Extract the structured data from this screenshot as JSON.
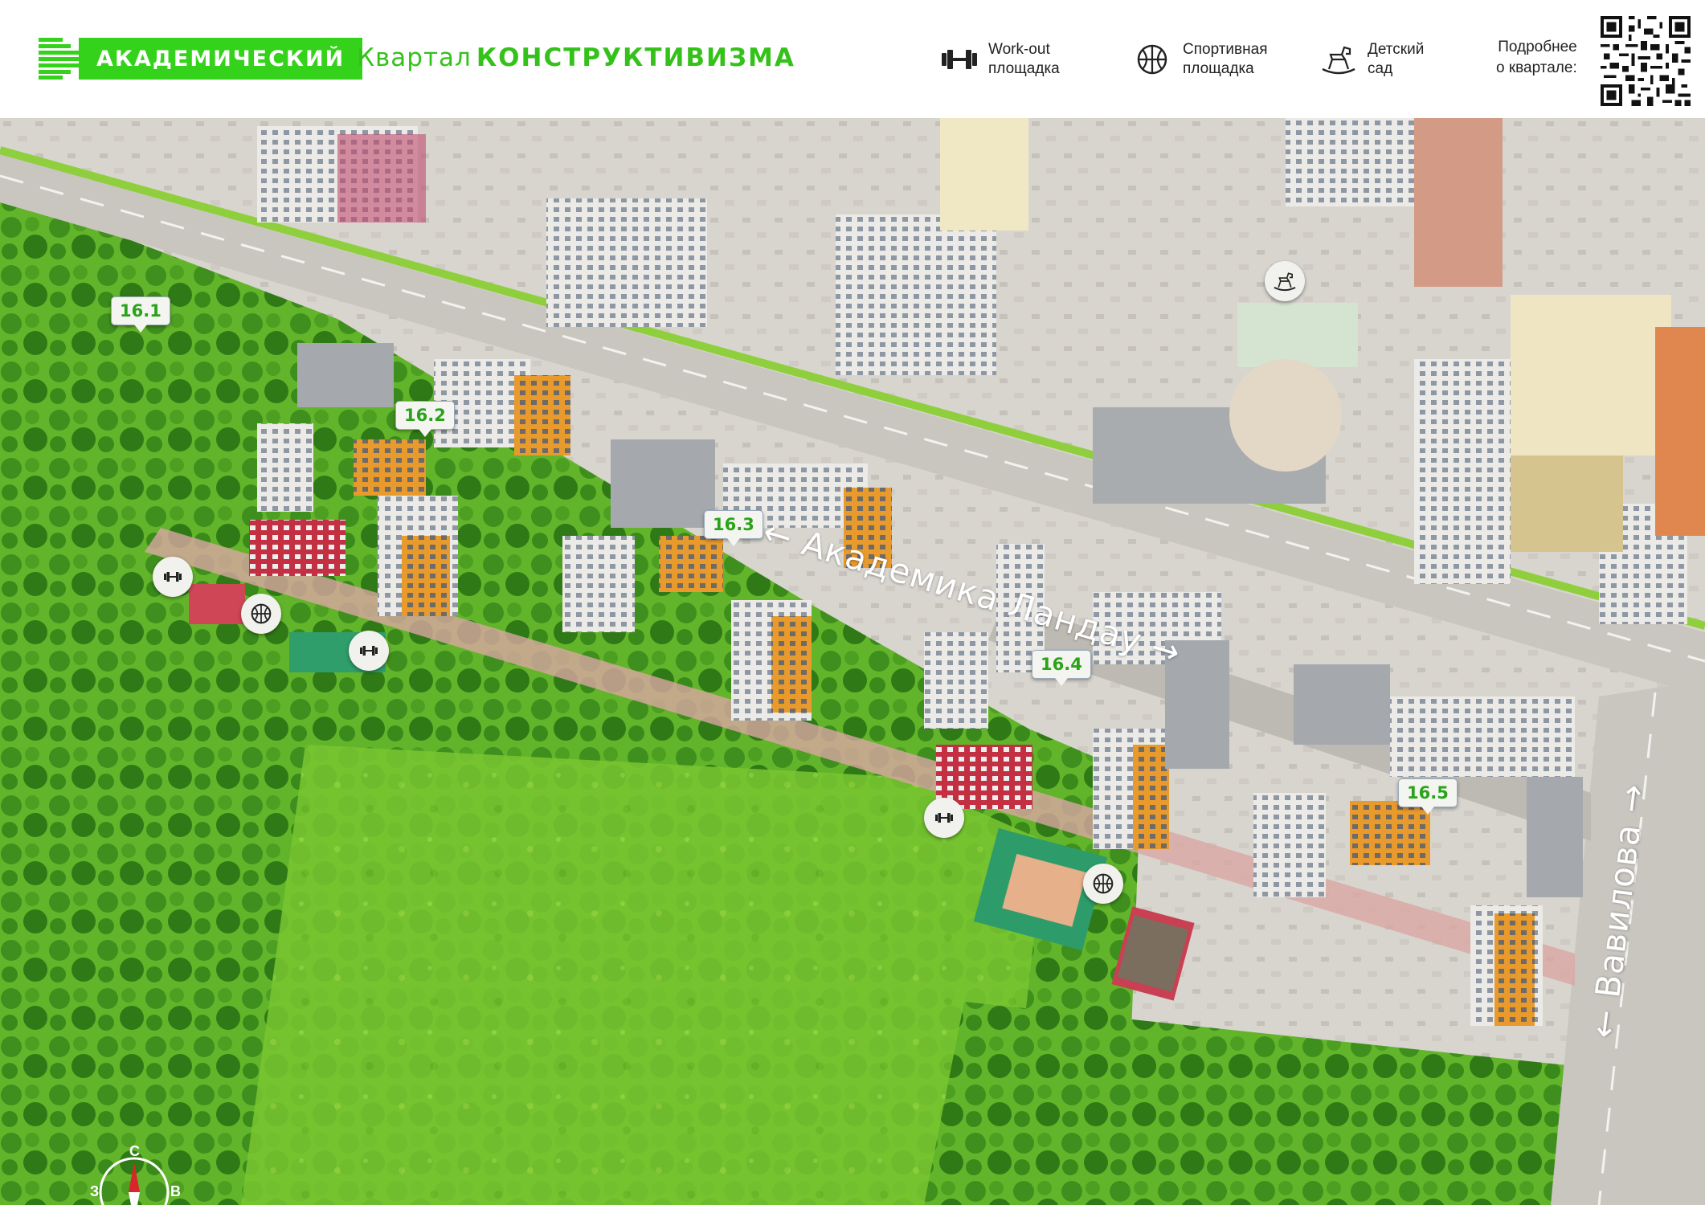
{
  "header": {
    "logo_text": "АКАДЕМИЧЕСКИЙ",
    "title_prefix": "Квартал",
    "title_emphasis": "КОНСТРУКТИВИЗМА",
    "legend": [
      {
        "icon": "dumbbell-icon",
        "line1": "Work-out",
        "line2": "площадка"
      },
      {
        "icon": "basketball-icon",
        "line1": "Спортивная",
        "line2": "площадка"
      },
      {
        "icon": "rocking-horse-icon",
        "line1": "Детский",
        "line2": "сад"
      }
    ],
    "more_line1": "Подробнее",
    "more_line2": "о квартале:",
    "qr_icon": "qr-code-icon"
  },
  "colors": {
    "brand_green": "#34d21a",
    "pin_text_green": "#2aa31a",
    "grass": "#6cc22a",
    "road": "#c9c6c0"
  },
  "map": {
    "plots": [
      {
        "id": "plot-16-1",
        "label": "16.1"
      },
      {
        "id": "plot-16-2",
        "label": "16.2"
      },
      {
        "id": "plot-16-3",
        "label": "16.3"
      },
      {
        "id": "plot-16-4",
        "label": "16.4"
      },
      {
        "id": "plot-16-5",
        "label": "16.5"
      }
    ],
    "streets": [
      {
        "id": "landau",
        "label": "← Академика Ландау →"
      },
      {
        "id": "vavilova",
        "label": "← Вавилова →"
      }
    ],
    "compass": {
      "north": "С",
      "west": "З",
      "east": "В"
    }
  }
}
